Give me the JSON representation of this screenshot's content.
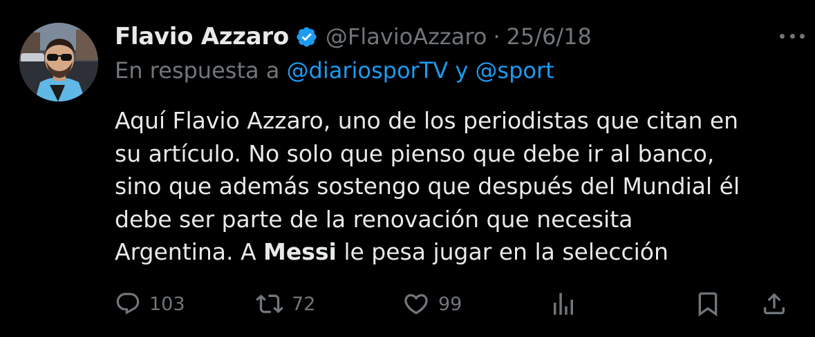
{
  "author": {
    "display_name": "Flavio Azzaro",
    "handle": "@FlavioAzzaro",
    "separator": "·",
    "date": "25/6/18",
    "verified_icon": "verified-badge-icon"
  },
  "reply": {
    "prefix": "En respuesta a",
    "mention1": "@diariosporTV",
    "conjunction": "y",
    "mention2": "@sport"
  },
  "body": {
    "line1": "Aquí Flavio Azzaro, uno de los periodistas que citan en",
    "line2": "su artículo. No solo que pienso que debe ir al banco,",
    "line3": "sino que además sostengo que después del Mundial él",
    "line4": "debe ser parte de la renovación que necesita",
    "line5_a": "Argentina. A ",
    "line5_bold": "Messi",
    "line5_b": " le pesa jugar en la selección"
  },
  "actions": {
    "replies": "103",
    "retweets": "72",
    "likes": "99"
  },
  "colors": {
    "background": "#000000",
    "text": "#e7e9ea",
    "secondary": "#71767b",
    "accent": "#1d9bf0"
  }
}
